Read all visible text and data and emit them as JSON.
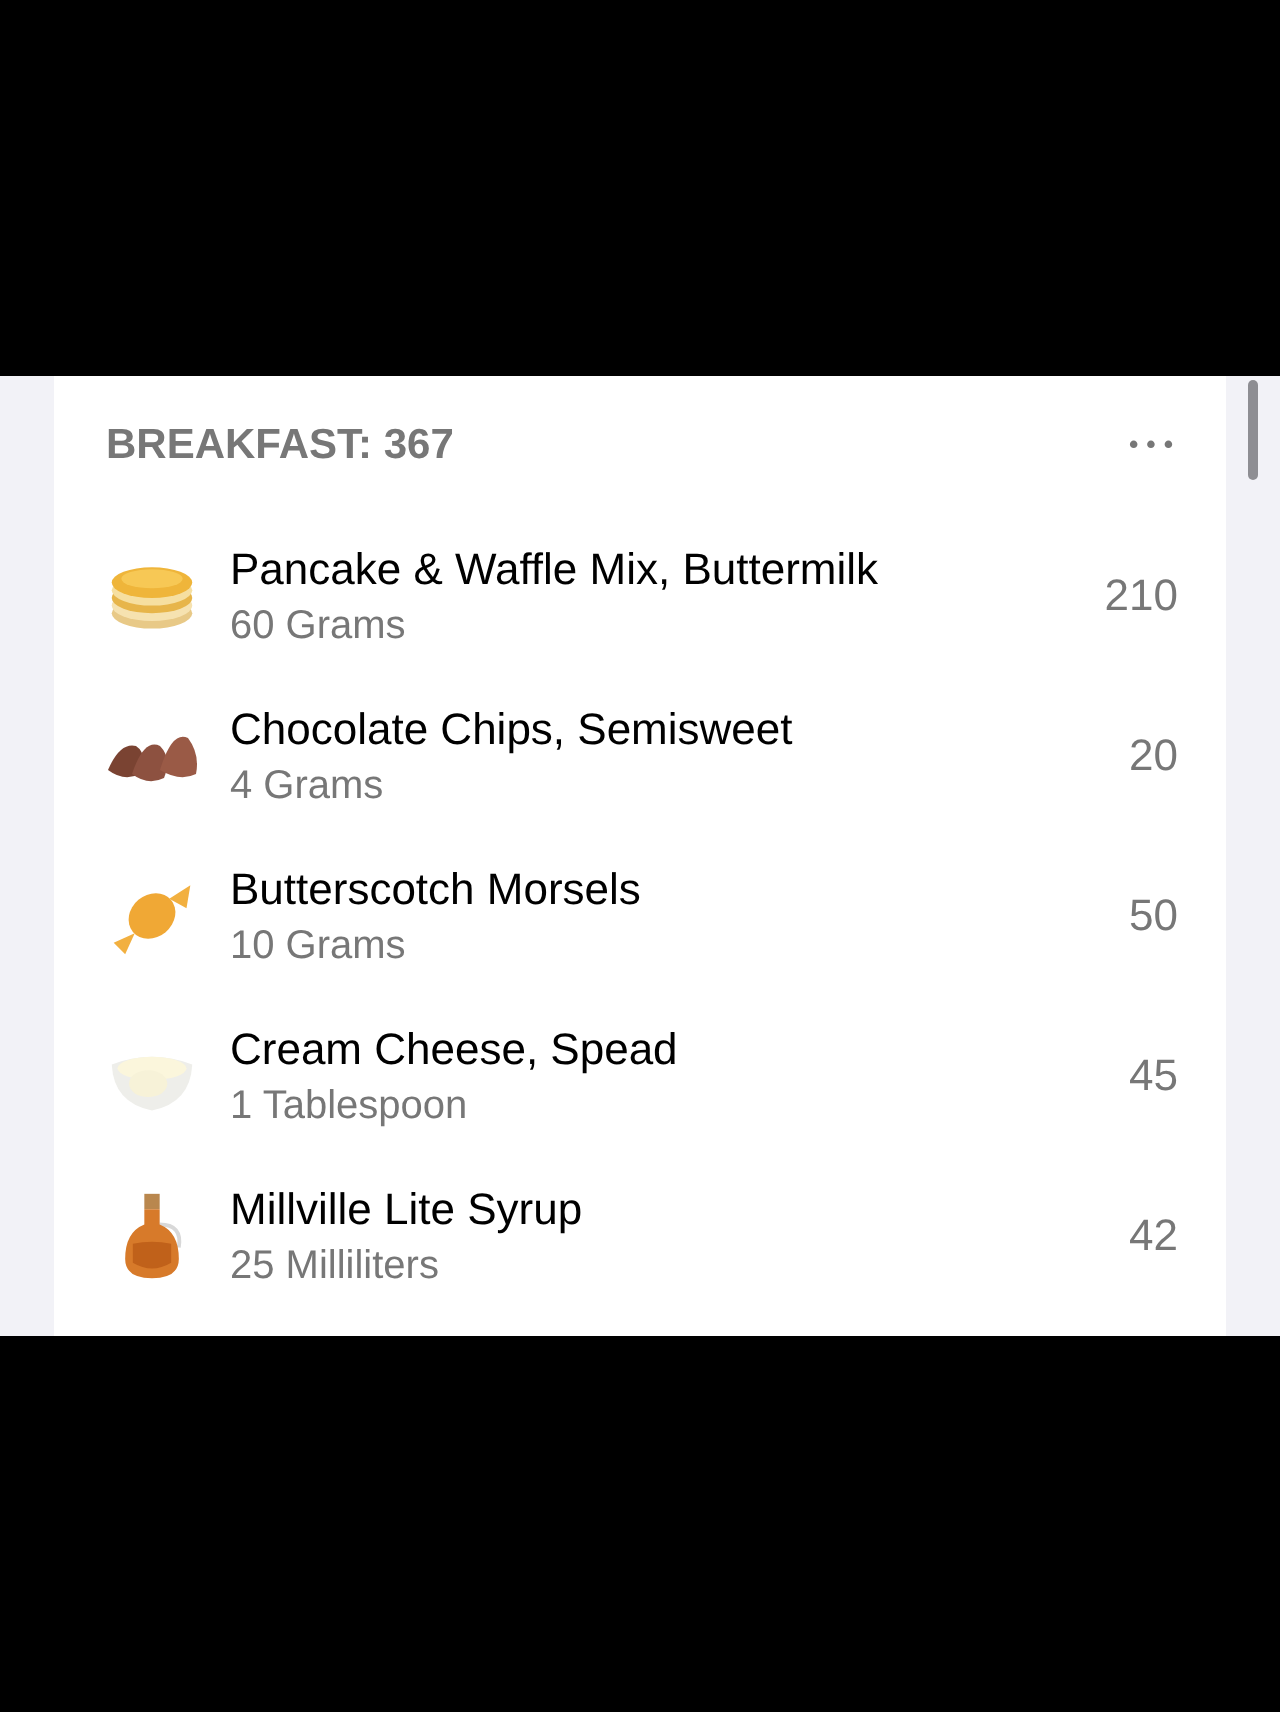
{
  "meal": {
    "title": "BREAKFAST: 367",
    "menu": "•••"
  },
  "items": [
    {
      "kind": "pancakes",
      "name": "Pancake & Waffle Mix, Buttermilk",
      "amount": "60 Grams",
      "calories": "210"
    },
    {
      "kind": "chips",
      "name": "Chocolate Chips, Semisweet",
      "amount": "4 Grams",
      "calories": "20"
    },
    {
      "kind": "candy",
      "name": "Butterscotch Morsels",
      "amount": "10 Grams",
      "calories": "50"
    },
    {
      "kind": "bowl",
      "name": "Cream Cheese, Spead",
      "amount": "1 Tablespoon",
      "calories": "45"
    },
    {
      "kind": "bottle",
      "name": "Millville Lite Syrup",
      "amount": "25 Milliliters",
      "calories": "42"
    }
  ]
}
